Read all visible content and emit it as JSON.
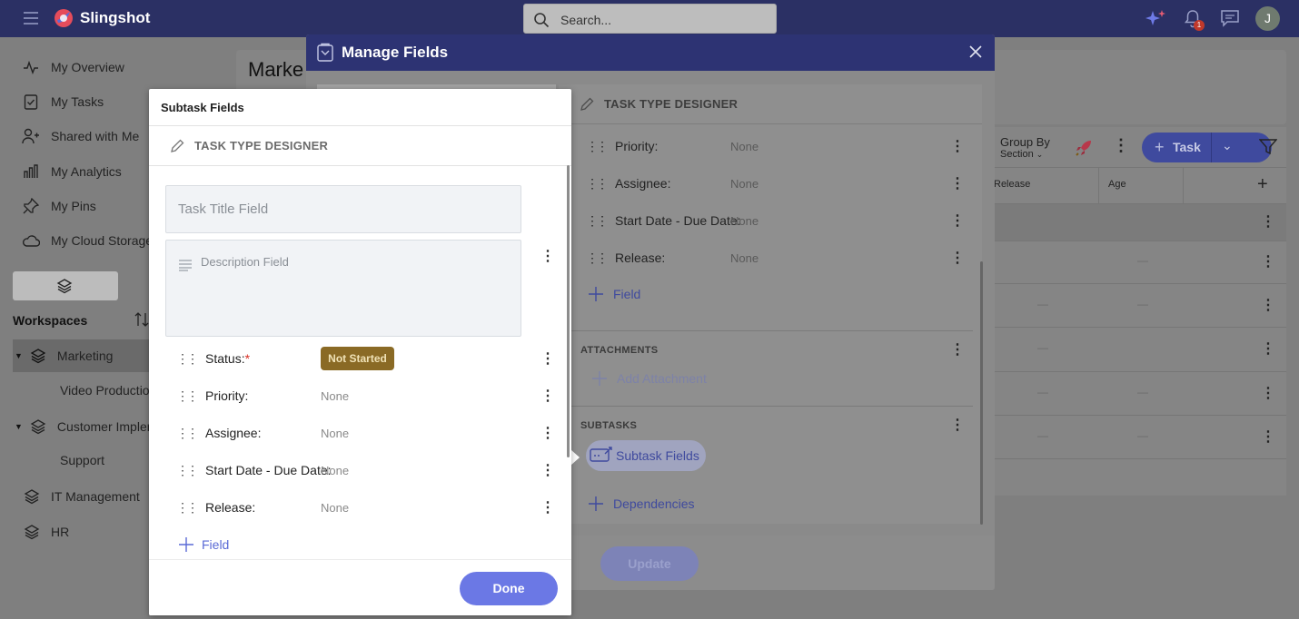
{
  "app": {
    "brand": "Slingshot",
    "search_placeholder": "Search...",
    "notification_count": "1",
    "avatar_initial": "J"
  },
  "sidebar": {
    "items": [
      {
        "label": "My Overview",
        "icon": "pulse-icon"
      },
      {
        "label": "My Tasks",
        "icon": "checklist-icon"
      },
      {
        "label": "Shared with Me",
        "icon": "shared-user-icon"
      },
      {
        "label": "My Analytics",
        "icon": "bar-chart-icon"
      },
      {
        "label": "My Pins",
        "icon": "pin-icon"
      },
      {
        "label": "My Cloud Storage",
        "icon": "cloud-icon"
      }
    ],
    "workspaces_title": "Workspaces",
    "workspaces": [
      {
        "label": "Marketing"
      },
      {
        "label": "Video Production"
      },
      {
        "label": "Customer Impleme"
      },
      {
        "label": "Support"
      },
      {
        "label": "IT Management"
      },
      {
        "label": "HR"
      }
    ]
  },
  "page": {
    "title": "Marke",
    "group_by_label": "Group By",
    "group_by_value": "Section",
    "add_task_label": "Task",
    "columns": [
      "Release",
      "Age"
    ]
  },
  "manage_fields": {
    "title": "Manage Fields",
    "designer_label": "TASK TYPE DESIGNER",
    "fields": [
      {
        "label": "Priority:",
        "value": "None"
      },
      {
        "label": "Assignee:",
        "value": "None"
      },
      {
        "label": "Start Date - Due Date:",
        "value": "None"
      },
      {
        "label": "Release:",
        "value": "None"
      }
    ],
    "add_field_label": "Field",
    "attachments_title": "ATTACHMENTS",
    "add_attachment_label": "Add Attachment",
    "subtasks_title": "SUBTASKS",
    "subtask_fields_label": "Subtask Fields",
    "dependencies_label": "Dependencies",
    "update_label": "Update"
  },
  "subtask_fields": {
    "title": "Subtask Fields",
    "designer_label": "TASK TYPE DESIGNER",
    "title_field_placeholder": "Task Title Field",
    "description_field_placeholder": "Description Field",
    "status_label": "Status:",
    "status_required": "*",
    "status_value": "Not Started",
    "fields": [
      {
        "label": "Priority:",
        "value": "None"
      },
      {
        "label": "Assignee:",
        "value": "None"
      },
      {
        "label": "Start Date - Due Date:",
        "value": "None"
      },
      {
        "label": "Release:",
        "value": "None"
      }
    ],
    "add_field_label": "Field",
    "done_label": "Done"
  },
  "colors": {
    "topbar": "#2b3064",
    "dialog_header": "#2d3373",
    "status_badge": "#8a6a25",
    "done_button": "#6b78e5",
    "link": "#3f4a9e"
  }
}
